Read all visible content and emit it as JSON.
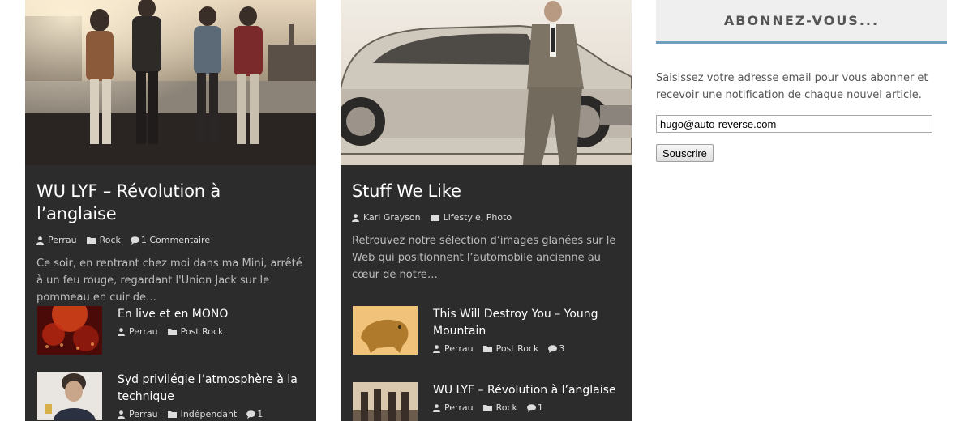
{
  "posts": [
    {
      "title": "WU LYF – Révolution à l’anglaise",
      "author": "Perrau",
      "category": "Rock",
      "comments": "1 Commentaire",
      "excerpt": "Ce soir, en rentrant chez moi dans ma Mini, arrêté à un feu rouge, regardant l'Union Jack sur le pommeau en cuir de…",
      "related": [
        {
          "title": "En live et en MONO",
          "author": "Perrau",
          "category": "Post Rock",
          "comments": ""
        },
        {
          "title": "Syd privilégie l’atmosphère à la technique",
          "author": "Perrau",
          "category": "Indépendant",
          "comments": "1"
        }
      ]
    },
    {
      "title": "Stuff We Like",
      "author": "Karl Grayson",
      "category": "Lifestyle",
      "category2": "Photo",
      "comments": "",
      "excerpt": "Retrouvez notre sélection d’images glanées sur le Web qui positionnent l’automobile ancienne  au cœur de notre…",
      "related": [
        {
          "title": "This Will Destroy You – Young Mountain",
          "author": "Perrau",
          "category": "Post Rock",
          "comments": "3"
        },
        {
          "title": "WU LYF – Révolution à l’anglaise",
          "author": "Perrau",
          "category": "Rock",
          "comments": "1"
        }
      ]
    }
  ],
  "subscribe": {
    "title": "ABONNEZ-VOUS...",
    "description": "Saisissez votre adresse email pour vous abonner et recevoir une notification de chaque nouvel article.",
    "email_value": "hugo@auto-reverse.com",
    "button_label": "Souscrire"
  },
  "icons": {
    "author": "user-icon",
    "category": "folder-icon",
    "comments": "comment-icon"
  },
  "colors": {
    "card_bg": "#2c2c2c",
    "widget_accent": "#6f9fbf",
    "widget_bg": "#efefef"
  }
}
